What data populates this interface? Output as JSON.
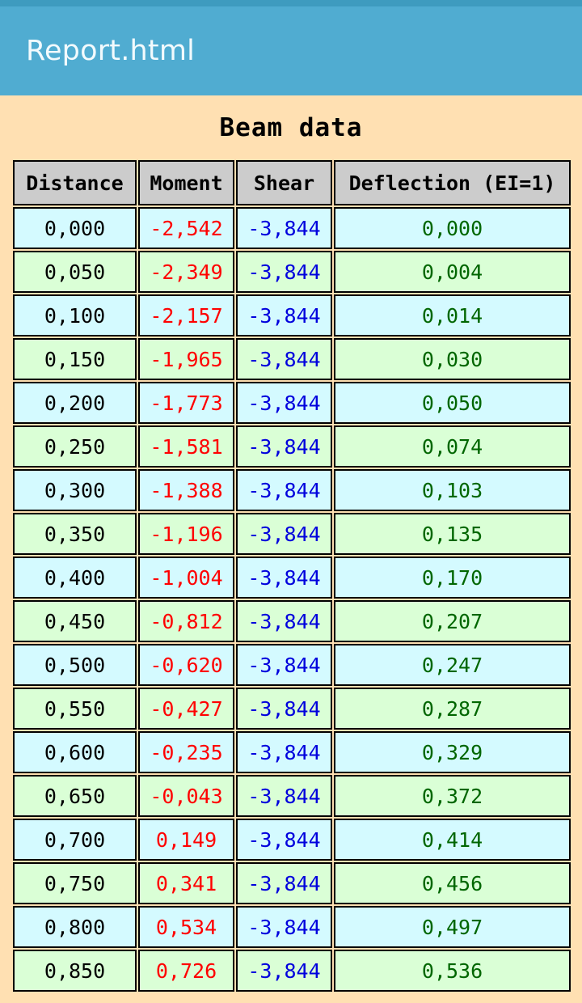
{
  "window": {
    "title": "Report.html"
  },
  "document": {
    "heading": "Beam data",
    "table": {
      "headers": [
        "Distance",
        "Moment",
        "Shear",
        "Deflection (EI=1)"
      ],
      "rows": [
        [
          "0,000",
          "-2,542",
          "-3,844",
          "0,000"
        ],
        [
          "0,050",
          "-2,349",
          "-3,844",
          "0,004"
        ],
        [
          "0,100",
          "-2,157",
          "-3,844",
          "0,014"
        ],
        [
          "0,150",
          "-1,965",
          "-3,844",
          "0,030"
        ],
        [
          "0,200",
          "-1,773",
          "-3,844",
          "0,050"
        ],
        [
          "0,250",
          "-1,581",
          "-3,844",
          "0,074"
        ],
        [
          "0,300",
          "-1,388",
          "-3,844",
          "0,103"
        ],
        [
          "0,350",
          "-1,196",
          "-3,844",
          "0,135"
        ],
        [
          "0,400",
          "-1,004",
          "-3,844",
          "0,170"
        ],
        [
          "0,450",
          "-0,812",
          "-3,844",
          "0,207"
        ],
        [
          "0,500",
          "-0,620",
          "-3,844",
          "0,247"
        ],
        [
          "0,550",
          "-0,427",
          "-3,844",
          "0,287"
        ],
        [
          "0,600",
          "-0,235",
          "-3,844",
          "0,329"
        ],
        [
          "0,650",
          "-0,043",
          "-3,844",
          "0,372"
        ],
        [
          "0,700",
          "0,149",
          "-3,844",
          "0,414"
        ],
        [
          "0,750",
          "0,341",
          "-3,844",
          "0,456"
        ],
        [
          "0,800",
          "0,534",
          "-3,844",
          "0,497"
        ],
        [
          "0,850",
          "0,726",
          "-3,844",
          "0,536"
        ]
      ]
    }
  },
  "colors": {
    "app_bar": "#50ACD1",
    "status_strip": "#3E9BBF",
    "page_background": "#FFE0B2",
    "header_cell": "#CCCCCC",
    "row_odd": "#D4FAFF",
    "row_even": "#DAFFD6",
    "distance_text": "#000000",
    "moment_text": "#FF0000",
    "shear_text": "#0000DD",
    "deflection_text": "#006600"
  }
}
